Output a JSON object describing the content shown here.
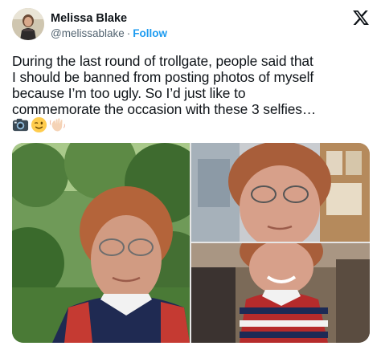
{
  "author": {
    "display_name": "Melissa Blake",
    "handle": "@melissablake",
    "separator": "·",
    "follow_label": "Follow"
  },
  "tweet": {
    "lines": [
      "During the last round of trollgate, people said that",
      "I should be banned from posting photos of myself",
      "because I’m too ugly. So I’d just like to",
      "commemorate the occasion with these 3 selfies…"
    ],
    "emojis": [
      "camera-icon",
      "winking-face-icon",
      "waving-hand-icon"
    ]
  },
  "media": {
    "photos": [
      {
        "name": "selfie-garden",
        "setting": "outdoor garden"
      },
      {
        "name": "selfie-office",
        "setting": "indoor office"
      },
      {
        "name": "selfie-smiling",
        "setting": "indoor"
      }
    ]
  },
  "colors": {
    "text": "#0f1419",
    "secondary": "#536471",
    "link": "#1d9bf0",
    "background": "#ffffff"
  }
}
